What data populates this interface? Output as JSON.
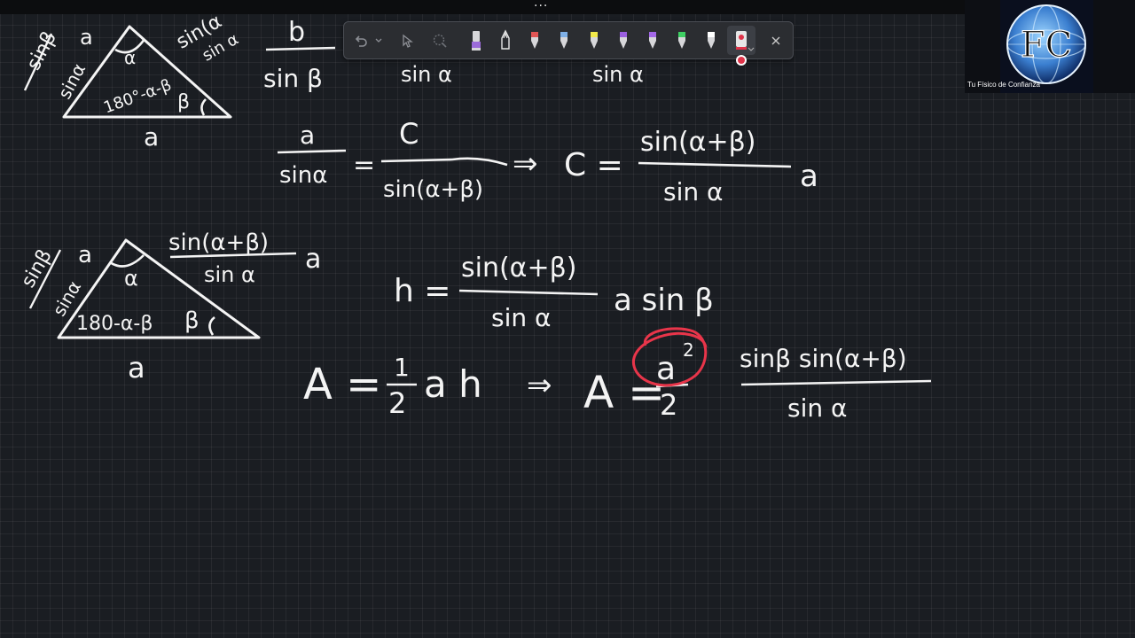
{
  "window": {
    "menu_dots": "...",
    "camera_caption": "Tu Físico de Confianza",
    "camera_logo": "FC"
  },
  "toolbar": {
    "tools": [
      {
        "name": "undo-icon"
      },
      {
        "name": "undo-dropdown-icon"
      },
      {
        "name": "select-icon"
      },
      {
        "name": "lasso-icon"
      },
      {
        "name": "highlighter-purple-icon",
        "color": "#9b6bd9"
      },
      {
        "name": "pen-outline-icon",
        "color": "#2b2d31"
      },
      {
        "name": "pen-red-icon",
        "color": "#e05555"
      },
      {
        "name": "pen-blue-icon",
        "color": "#7fb0e6"
      },
      {
        "name": "pen-yellow-icon",
        "color": "#f2e94a"
      },
      {
        "name": "pen-violet-icon",
        "color": "#9a5fe0"
      },
      {
        "name": "pen-purple-icon",
        "color": "#a368e8"
      },
      {
        "name": "pen-green-icon",
        "color": "#3ecf63"
      },
      {
        "name": "pen-white-icon",
        "color": "#ffffff"
      },
      {
        "name": "pen-record-icon",
        "color": "#e0344a"
      },
      {
        "name": "close-icon"
      }
    ]
  },
  "board": {
    "ink_color": "#f4f4f4",
    "highlight_color": "#e8354a",
    "equations": {
      "top_fragment_b": "b",
      "top_fragment_sinbeta": "sin β",
      "top_fragment_sinalpha_1": "sin α",
      "top_fragment_sinalpha_2": "sin α",
      "eq1_num": "a",
      "eq1_den": "sinα",
      "eq1_eq": "=",
      "eq1_rhs_num": "C",
      "eq1_rhs_den": "sin(α+β)",
      "eq1_implies": "⇒",
      "eq1_c": "C =",
      "eq1_frac_num": "sin(α+β)",
      "eq1_frac_den": "sin α",
      "eq1_a": "a",
      "eq2_h": "h =",
      "eq2_num": "sin(α+β)",
      "eq2_den": "sin α",
      "eq2_tail": "a sin β",
      "eq3_A": "A =",
      "eq3_half_num": "1",
      "eq3_half_den": "2",
      "eq3_ah": "a h",
      "eq3_implies": "⇒",
      "eq3_A2": "A =",
      "eq3_a2": "a",
      "eq3_sup": "2",
      "eq3_den2": "2",
      "eq3_frac_num": "sinβ sin(α+β)",
      "eq3_frac_den": "sin α"
    },
    "triangle_top": {
      "left_label_top": "sinβ",
      "left_label_a": "a",
      "left_label_bottom": "sinα",
      "top_right_label_1": "sin(α",
      "top_right_label_2": "sin α",
      "alpha": "α",
      "angle_expr": "180°-α-β",
      "beta": "β",
      "base": "a"
    },
    "triangle_bottom": {
      "left_label_top": "sinβ",
      "left_label_a": "a",
      "left_label_bottom": "sinα",
      "right_num": "sin(α+β)",
      "right_den": "sin α",
      "right_a": "a",
      "alpha": "α",
      "angle_expr": "180-α-β",
      "beta": "β",
      "base": "a"
    }
  }
}
